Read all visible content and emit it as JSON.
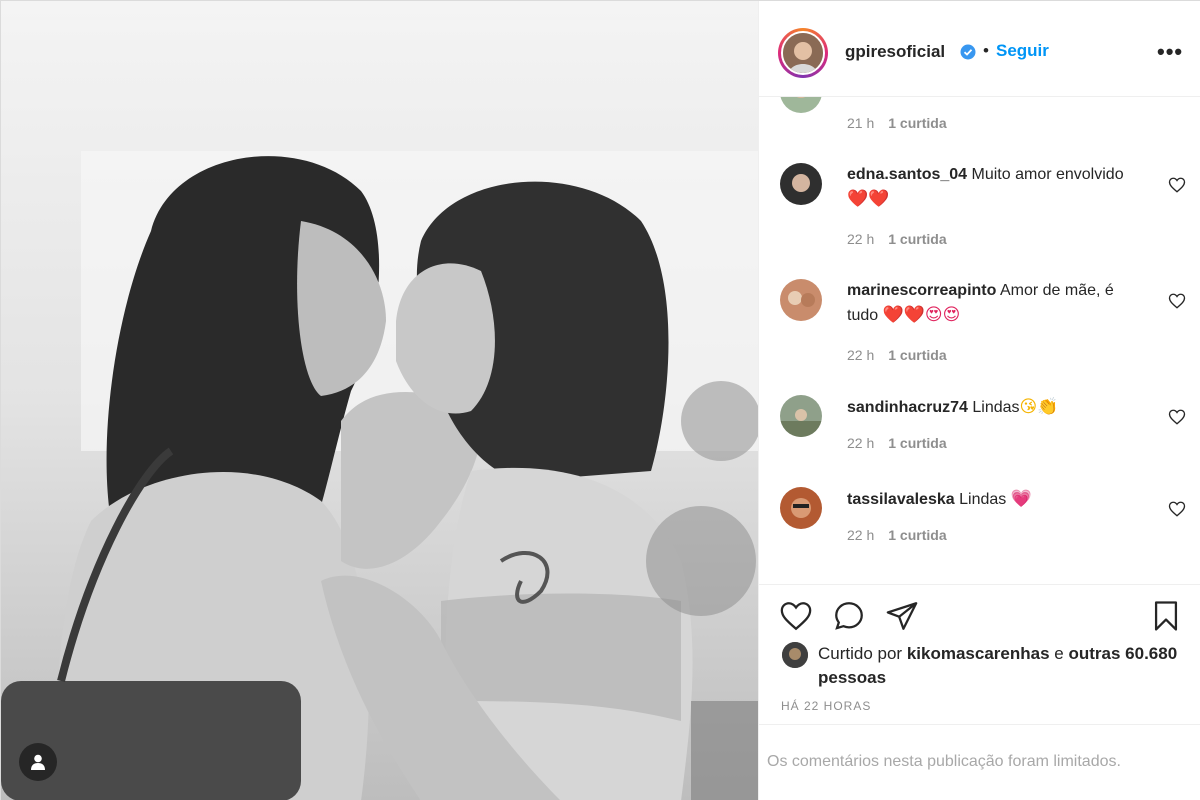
{
  "header": {
    "username": "gpiresoficial",
    "separator": "•",
    "follow_label": "Seguir",
    "more_label": "•••",
    "verified_icon": "verified-badge-icon"
  },
  "comments": [
    {
      "user": "",
      "text": "",
      "time": "21 h",
      "likes": "1 curtida"
    },
    {
      "user": "edna.santos_04",
      "text": "Muito amor envolvido",
      "emoji": "❤️❤️",
      "time": "22 h",
      "likes": "1 curtida"
    },
    {
      "user": "marinescorreapinto",
      "text": "Amor de mãe, é tudo",
      "emoji": "❤️❤️😍😍",
      "time": "22 h",
      "likes": "1 curtida"
    },
    {
      "user": "sandinhacruz74",
      "text": "Lindas",
      "emoji": "😘👏",
      "time": "22 h",
      "likes": "1 curtida"
    },
    {
      "user": "tassilavaleska",
      "text": "Lindas",
      "emoji": "💗",
      "time": "22 h",
      "likes": "1 curtida"
    }
  ],
  "actions": {
    "like_icon": "heart-icon",
    "comment_icon": "comment-bubble-icon",
    "share_icon": "paper-plane-icon",
    "save_icon": "bookmark-icon",
    "liked_by_prefix": "Curtido por",
    "liked_by_user": "kikomascarenhas",
    "liked_by_conj": "e",
    "liked_by_others": "outras 60.680 pessoas",
    "timestamp": "HÁ 22 HORAS"
  },
  "footer": {
    "limited_text": "Os comentários nesta publicação foram limitados."
  },
  "colors": {
    "accent": "#0095f6",
    "text": "#262626",
    "muted": "#8e8e8e",
    "border": "#efefef"
  }
}
